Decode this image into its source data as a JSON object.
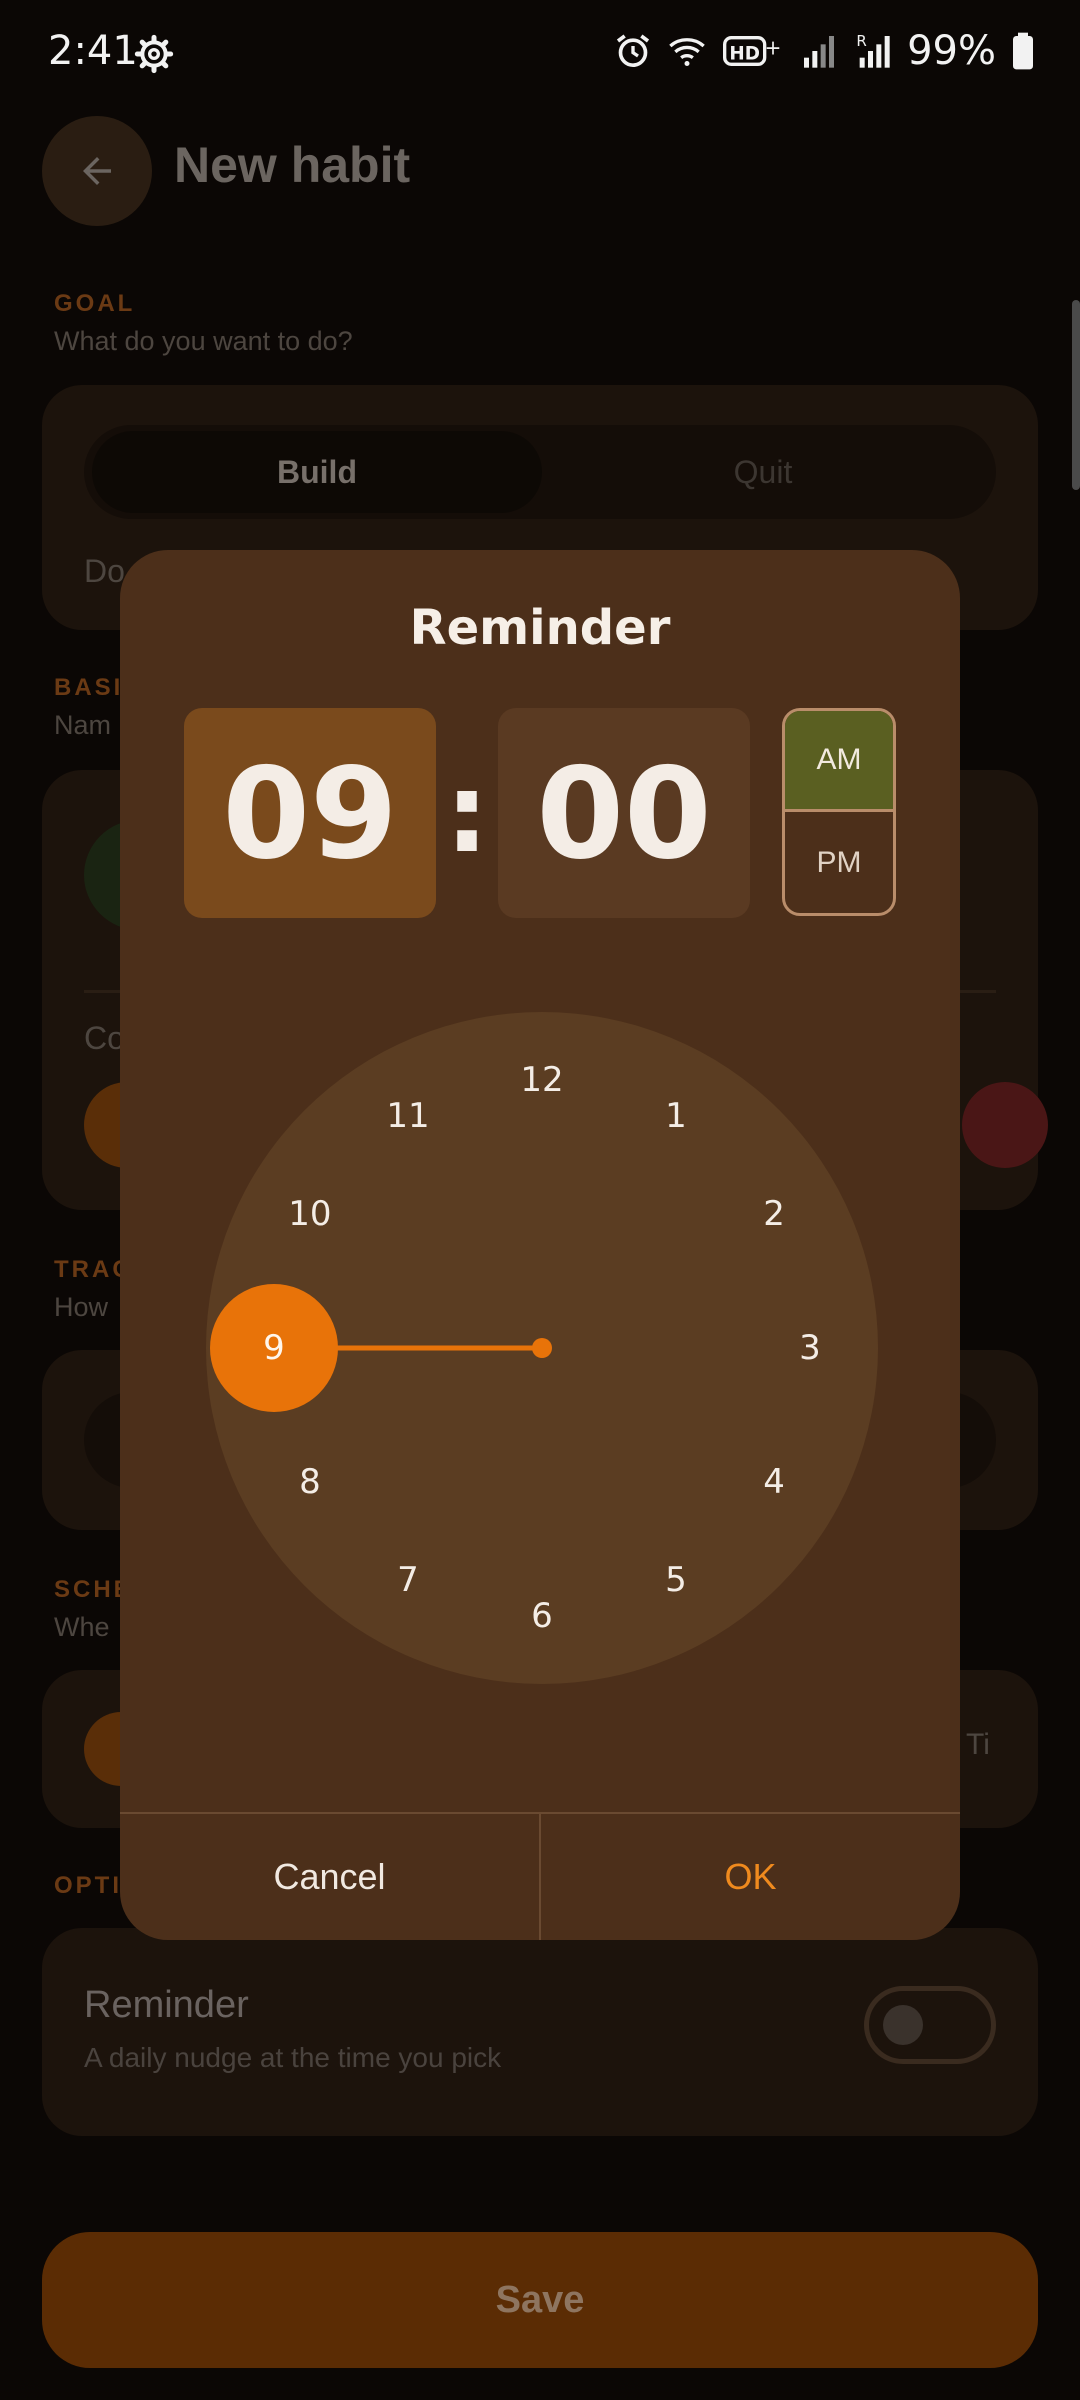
{
  "status_bar": {
    "time": "2:41",
    "battery": "99%",
    "icons": [
      "gear-icon",
      "alarm-icon",
      "wifi-icon",
      "hd-voice-icon",
      "signal-icon",
      "roaming-signal-icon",
      "battery-icon"
    ]
  },
  "page": {
    "title": "New habit",
    "goal": {
      "label": "GOAL",
      "sub": "What do you want to do?",
      "segments": [
        "Build",
        "Quit"
      ],
      "selected_segment": "Build",
      "field_fragment": "Do"
    },
    "basics": {
      "label_fragment": "BASI",
      "sub_fragment": "Nam",
      "color_fragment": "Co"
    },
    "tracking": {
      "label_fragment": "TRAC",
      "sub_fragment": "How"
    },
    "schedule": {
      "label_fragment": "SCHE",
      "sub_fragment": "Whe",
      "chip_fragment": "Ti"
    },
    "optional": {
      "label_fragment": "OPTI",
      "reminder_title": "Reminder",
      "reminder_sub": "A daily nudge at the time you pick",
      "reminder_enabled": false
    },
    "save_label": "Save"
  },
  "dialog": {
    "title": "Reminder",
    "hour": "09",
    "separator": ":",
    "minute": "00",
    "am_label": "AM",
    "pm_label": "PM",
    "period_selected": "AM",
    "clock_numbers": [
      "12",
      "1",
      "2",
      "3",
      "4",
      "5",
      "6",
      "7",
      "8",
      "9",
      "10",
      "11"
    ],
    "selected_hour": 9,
    "cancel_label": "Cancel",
    "ok_label": "OK"
  },
  "colors": {
    "accent": "#e87309",
    "dialog_bg": "#4c2f1a",
    "clock_face": "#5b3d22",
    "am_selected": "#5a5f21",
    "save_button": "#5b2c04"
  }
}
